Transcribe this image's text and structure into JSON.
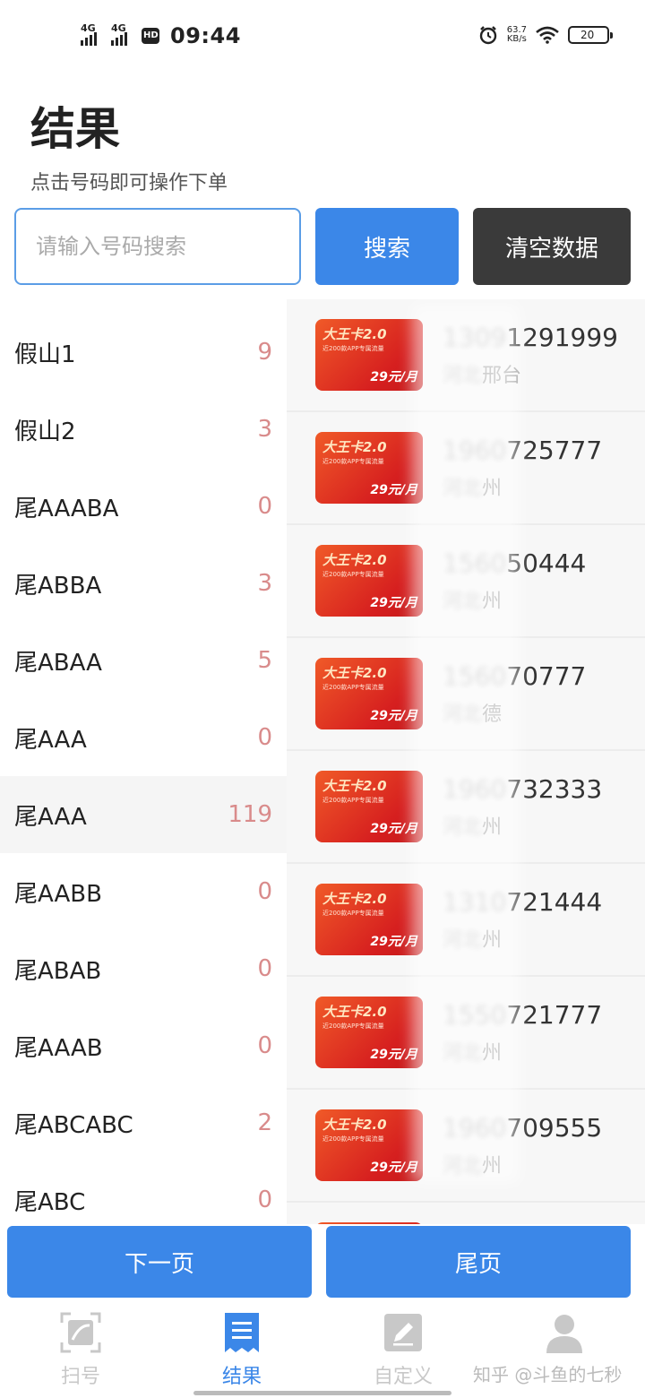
{
  "status_bar": {
    "time": "09:44",
    "signal1": "4G",
    "signal2": "4G",
    "hd": "HD",
    "speed_value": "63.7",
    "speed_unit": "KB/s",
    "battery": "20"
  },
  "header": {
    "title": "结果",
    "subtitle": "点击号码即可操作下单"
  },
  "search": {
    "placeholder": "请输入号码搜索",
    "search_label": "搜索",
    "clear_label": "清空数据"
  },
  "categories": [
    {
      "name": "假山1",
      "count": "9"
    },
    {
      "name": "假山2",
      "count": "3"
    },
    {
      "name": "尾AAABA",
      "count": "0"
    },
    {
      "name": "尾ABBA",
      "count": "3"
    },
    {
      "name": "尾ABAA",
      "count": "5"
    },
    {
      "name": "尾AAA",
      "count": "0"
    },
    {
      "name": "尾AAA",
      "count": "119"
    },
    {
      "name": "尾AABB",
      "count": "0"
    },
    {
      "name": "尾ABAB",
      "count": "0"
    },
    {
      "name": "尾AAAB",
      "count": "0"
    },
    {
      "name": "尾ABCABC",
      "count": "2"
    },
    {
      "name": "尾ABC",
      "count": "0"
    }
  ],
  "card": {
    "title": "大王卡2.0",
    "subtitle": "近200款APP专属流量",
    "price": "29元/月"
  },
  "results": [
    {
      "masked": "1309",
      "tail": "1291999",
      "loc_masked": "河北",
      "loc_tail": "邢台"
    },
    {
      "masked": "1960",
      "tail": "725777",
      "loc_masked": "河北",
      "loc_tail": "州"
    },
    {
      "masked": "1560",
      "tail": "50444",
      "loc_masked": "河北",
      "loc_tail": "州"
    },
    {
      "masked": "1560",
      "tail": "70777",
      "loc_masked": "河北",
      "loc_tail": "德"
    },
    {
      "masked": "1960",
      "tail": "732333",
      "loc_masked": "河北",
      "loc_tail": "州"
    },
    {
      "masked": "1310",
      "tail": "721444",
      "loc_masked": "河北",
      "loc_tail": "州"
    },
    {
      "masked": "1550",
      "tail": "721777",
      "loc_masked": "河北",
      "loc_tail": "州"
    },
    {
      "masked": "1960",
      "tail": "709555",
      "loc_masked": "河北",
      "loc_tail": "州"
    },
    {
      "masked": "",
      "tail": "",
      "loc_masked": "",
      "loc_tail": ""
    }
  ],
  "pagination": {
    "next_label": "下一页",
    "last_label": "尾页"
  },
  "tabs": [
    {
      "label": "扫号",
      "icon": "scan-icon",
      "active": false
    },
    {
      "label": "结果",
      "icon": "receipt-list-icon",
      "active": true
    },
    {
      "label": "自定义",
      "icon": "edit-icon",
      "active": false
    },
    {
      "label": "",
      "icon": "user-icon",
      "active": false
    }
  ],
  "watermark": "知乎 @斗鱼的七秒",
  "colors": {
    "primary": "#3b87e8",
    "dark_button": "#3a3a3a",
    "count_color": "#d98b8b",
    "card_red": "#d61f1f"
  }
}
